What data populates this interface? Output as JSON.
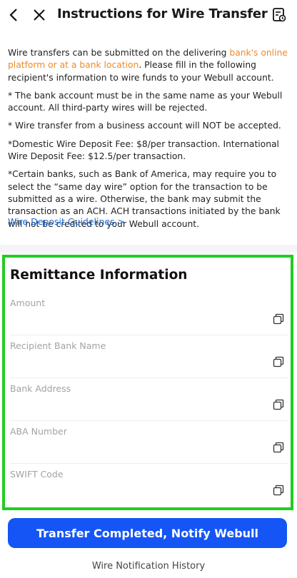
{
  "header": {
    "title": "Instructions for Wire Transfer",
    "icons": [
      "back-chevron-icon",
      "close-icon",
      "document-icon"
    ]
  },
  "intro": {
    "paragraph_prefix": "Wire transfers can be submitted on the delivering ",
    "paragraph_link": "bank's online platform or at a bank location",
    "paragraph_suffix": ". Please fill in the following recipient's information to wire funds to your Webull account.",
    "note1": "* The bank account must be in the same name as your Webull account. All third-party wires will be rejected.",
    "note2": "* Wire transfer from a business account will NOT be accepted.",
    "note3": "*Domestic Wire Deposit Fee: $8/per transaction. International Wire Deposit Fee: $12.5/per transaction.",
    "note4": "*Certain banks, such as Bank of America, may require you to select the “same day wire” option for the transaction to be submitted as a wire. Otherwise, the bank may submit the transaction as an ACH. ACH transactions initiated by the bank will not be credited to your Webull account.",
    "guidelines_link": "Wire Deposit Guidelines >"
  },
  "remittance": {
    "title": "Remittance Information",
    "fields": [
      {
        "label": "Amount"
      },
      {
        "label": "Recipient Bank Name"
      },
      {
        "label": "Bank Address"
      },
      {
        "label": "ABA Number"
      },
      {
        "label": "SWIFT Code"
      }
    ]
  },
  "actions": {
    "primary_button": "Transfer Completed, Notify Webull",
    "history_link": "Wire Notification History"
  },
  "colors": {
    "accent_blue": "#1555f5",
    "link_orange": "#f08a24",
    "link_blue": "#1e6bd6",
    "highlight_green": "#22cc22"
  }
}
